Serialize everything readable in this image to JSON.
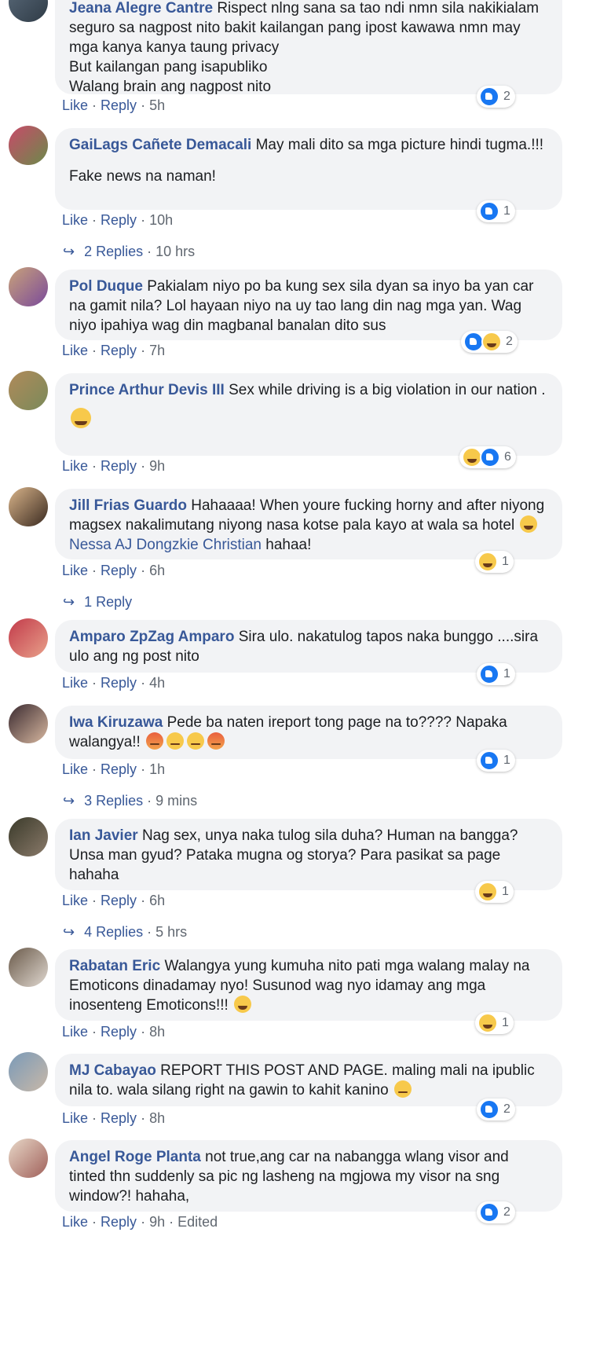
{
  "comments": [
    {
      "author": "Jeana Alegre Cantre",
      "paras": [
        "Rispect nlng sana sa tao ndi nmn sila nakikialam seguro sa nagpost nito bakit kailangan pang ipost kawawa nmn may mga kanya kanya taung privacy\nBut kailangan pang isapubliko\nWalang brain ang nagpost nito"
      ],
      "like": "Like",
      "reply": "Reply",
      "time": "5h",
      "reaction_count": "2",
      "avatar_colors": [
        "#5a6a7a",
        "#2f3b46"
      ]
    },
    {
      "author": "GaiLags Cañete Demacali",
      "paras": [
        "May mali dito sa mga picture hindi tugma.!!!",
        "Fake news na naman!"
      ],
      "like": "Like",
      "reply": "Reply",
      "time": "10h",
      "reaction_count": "1",
      "replies_label": "2 Replies",
      "replies_time": "10 hrs",
      "avatar_colors": [
        "#c84a6a",
        "#6b8a4a"
      ]
    },
    {
      "author": "Pol Duque",
      "paras": [
        "Pakialam niyo po ba kung sex sila dyan sa inyo ba yan car na gamit nila? Lol hayaan niyo na uy tao lang din nag mga yan. Wag niyo ipahiya wag din magbanal banalan dito sus"
      ],
      "like": "Like",
      "reply": "Reply",
      "time": "7h",
      "reaction_count": "2",
      "avatar_colors": [
        "#c9a27a",
        "#7a4a9a"
      ]
    },
    {
      "author": "Prince Arthur Devis III",
      "paras": [
        "Sex while driving is a big violation in our nation .",
        ""
      ],
      "like": "Like",
      "reply": "Reply",
      "time": "9h",
      "reaction_count": "6",
      "avatar_colors": [
        "#b08a5a",
        "#7a8a5a"
      ]
    },
    {
      "author": "Jill Frias Guardo",
      "paras": [
        "Hahaaaa! When youre fucking horny and after niyong magsex nakalimutang niyong nasa kotse pala kayo at wala sa hotel "
      ],
      "mention": "Nessa AJ Dongzkie Christian",
      "after_mention": " hahaa!",
      "like": "Like",
      "reply": "Reply",
      "time": "6h",
      "reaction_count": "1",
      "replies_label": "1 Reply",
      "replies_time": "",
      "avatar_colors": [
        "#d9b48a",
        "#3a2a20"
      ]
    },
    {
      "author": "Amparo ZpZag Amparo",
      "paras": [
        "Sira ulo. nakatulog tapos naka bunggo ....sira ulo ang ng post nito"
      ],
      "like": "Like",
      "reply": "Reply",
      "time": "4h",
      "reaction_count": "1",
      "avatar_colors": [
        "#c23a4a",
        "#e8a08a"
      ]
    },
    {
      "author": "Iwa Kiruzawa",
      "paras": [
        "Pede ba naten ireport tong page na to???? Napaka walangya!! "
      ],
      "like": "Like",
      "reply": "Reply",
      "time": "1h",
      "reaction_count": "1",
      "replies_label": "3 Replies",
      "replies_time": "9 mins",
      "avatar_colors": [
        "#3a2a30",
        "#d8b8a0"
      ]
    },
    {
      "author": "Ian Javier",
      "paras": [
        "Nag sex, unya naka tulog sila duha? Human na bangga? Unsa man gyud? Pataka mugna og storya? Para pasikat sa page hahaha"
      ],
      "like": "Like",
      "reply": "Reply",
      "time": "6h",
      "reaction_count": "1",
      "replies_label": "4 Replies",
      "replies_time": "5 hrs",
      "avatar_colors": [
        "#3a3a2a",
        "#8a7a6a"
      ]
    },
    {
      "author": "Rabatan Eric",
      "paras": [
        "Walangya yung kumuha nito pati mga walang malay na Emoticons dinadamay nyo! Susunod wag nyo idamay ang mga inosenteng Emoticons!!! "
      ],
      "like": "Like",
      "reply": "Reply",
      "time": "8h",
      "reaction_count": "1",
      "avatar_colors": [
        "#6a5a4a",
        "#e0d8d0"
      ]
    },
    {
      "author": "MJ Cabayao",
      "paras": [
        "REPORT THIS POST AND PAGE. maling mali na ipublic nila to. wala silang right na gawin to kahit kanino "
      ],
      "like": "Like",
      "reply": "Reply",
      "time": "8h",
      "reaction_count": "2",
      "avatar_colors": [
        "#7a9ab8",
        "#c8b8a8"
      ]
    },
    {
      "author": "Angel Roge Planta",
      "paras": [
        "not true,ang car na nabangga wlang visor and tinted thn suddenly sa pic ng lasheng na mgjowa my visor na sng window?! hahaha,"
      ],
      "like": "Like",
      "reply": "Reply",
      "time": "9h",
      "edited": "Edited",
      "reaction_count": "2",
      "avatar_colors": [
        "#e8d8c8",
        "#a0605a"
      ]
    }
  ]
}
